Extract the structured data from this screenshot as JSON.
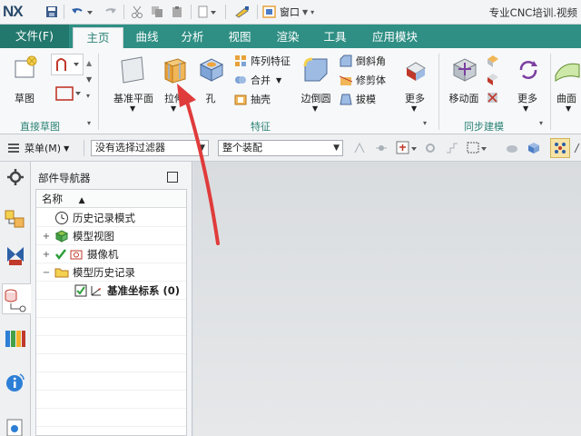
{
  "titlebar": {
    "logo": "NX",
    "window_menu_label": "窗口",
    "app_title": "专业CNC培训.视频"
  },
  "tabs": {
    "file": "文件(F)",
    "items": [
      "主页",
      "曲线",
      "分析",
      "视图",
      "渲染",
      "工具",
      "应用模块"
    ]
  },
  "ribbon": {
    "sketch_label": "草图",
    "direct_sketch_group": "直接草图",
    "datum_plane_label": "基准平面",
    "extrude_label": "拉伸",
    "hole_label": "孔",
    "pattern_feature": "阵列特征",
    "unite": "合并",
    "shell": "抽壳",
    "edge_blend_label": "边倒圆",
    "chamfer": "倒斜角",
    "trim_body": "修剪体",
    "draft": "拔模",
    "more_label": "更多",
    "feature_group": "特征",
    "move_face_label": "移动面",
    "more2_label": "更多",
    "sync_group": "同步建模",
    "surface_label": "曲面"
  },
  "filterbar": {
    "menu_label": "菜单(M)",
    "filter_value": "没有选择过滤器",
    "scope_value": "整个装配"
  },
  "navigator": {
    "title": "部件导航器",
    "column_name": "名称",
    "nodes": [
      {
        "label": "历史记录模式",
        "bold": false
      },
      {
        "label": "模型视图",
        "bold": false
      },
      {
        "label": "摄像机",
        "bold": false
      },
      {
        "label": "模型历史记录",
        "bold": false
      },
      {
        "label": "基准坐标系 (0)",
        "bold": true
      }
    ]
  },
  "colors": {
    "tab_bar": "#2f8f84",
    "accent": "#2c8377",
    "arrow": "#e03b3b"
  }
}
